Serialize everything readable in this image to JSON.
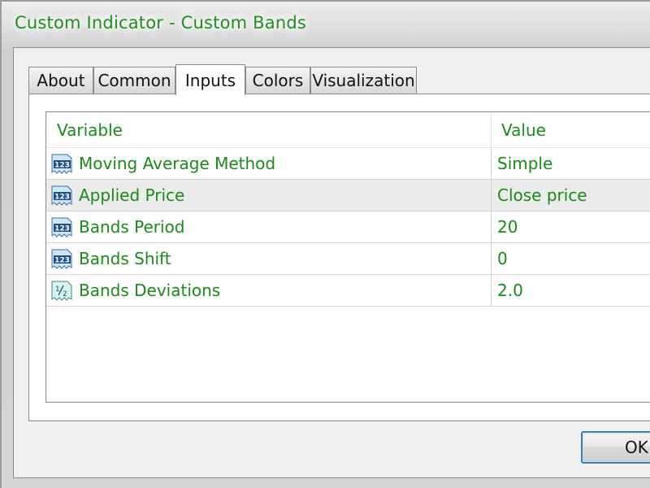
{
  "window": {
    "title": "Custom Indicator - Custom Bands"
  },
  "tabs": [
    {
      "label": "About"
    },
    {
      "label": "Common"
    },
    {
      "label": "Inputs"
    },
    {
      "label": "Colors"
    },
    {
      "label": "Visualization"
    }
  ],
  "active_tab": "Inputs",
  "table": {
    "columns": {
      "variable": "Variable",
      "value": "Value"
    },
    "rows": [
      {
        "icon": "integer-123-icon",
        "variable": "Moving Average Method",
        "value": "Simple"
      },
      {
        "icon": "integer-123-icon",
        "variable": "Applied Price",
        "value": "Close price"
      },
      {
        "icon": "integer-123-icon",
        "variable": "Bands Period",
        "value": "20"
      },
      {
        "icon": "integer-123-icon",
        "variable": "Bands Shift",
        "value": "0"
      },
      {
        "icon": "fraction-half-icon",
        "variable": "Bands Deviations",
        "value": "2.0"
      }
    ]
  },
  "buttons": {
    "ok": "OK"
  },
  "colors": {
    "text_accent": "#1a8a1a",
    "title": "#1f8f1f",
    "focus_border": "#3c7fb1"
  }
}
